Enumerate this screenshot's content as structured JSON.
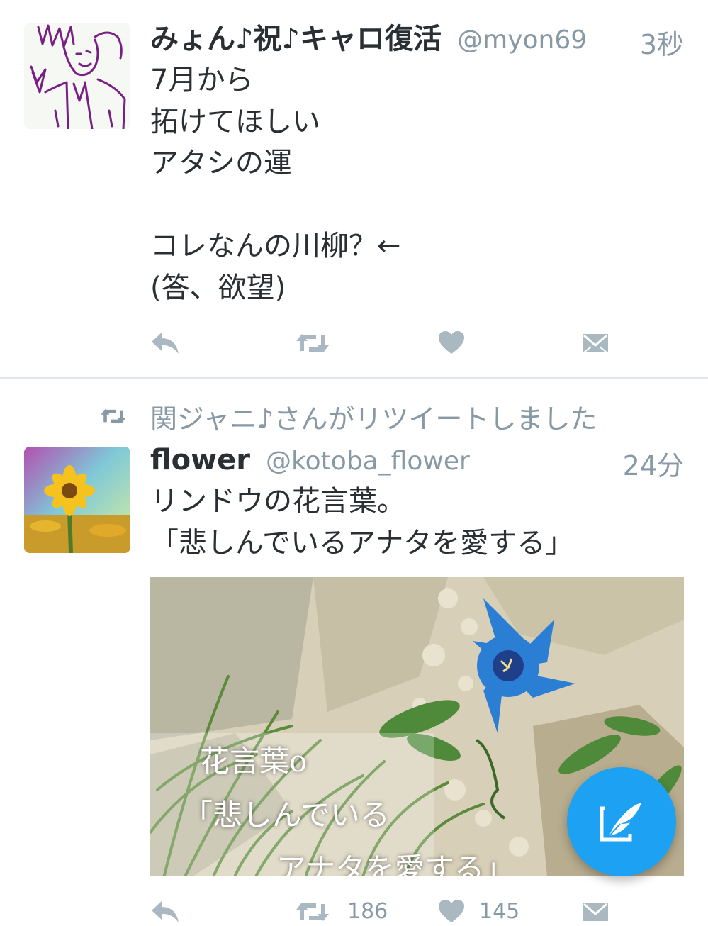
{
  "tweets": [
    {
      "display_name": "みょん♪祝♪キャロ復活",
      "handle": "@myon69",
      "time": "3秒",
      "lines": [
        "7月から",
        "拓けてほしい",
        "アタシの運",
        "",
        "コレなんの川柳？←",
        "(答、欲望)"
      ]
    },
    {
      "retweeted_by": "関ジャニ♪さんがリツイートしました",
      "display_name": "flower",
      "handle": "@kotoba_flower",
      "time": "24分",
      "lines": [
        "リンドウの花言葉。",
        "「悲しんでいるアナタを愛する」"
      ],
      "media_overlay": [
        "花言葉o",
        "「悲しんでいる",
        "アナタを愛する」"
      ],
      "retweet_count": "186",
      "like_count": "145"
    }
  ],
  "icons": {
    "reply": "reply-icon",
    "retweet": "retweet-icon",
    "like": "heart-icon",
    "dm": "envelope-icon",
    "compose": "compose-quill-icon"
  },
  "colors": {
    "accent": "#1da1f2",
    "muted": "#8899a6",
    "text": "#292f33",
    "divider": "#e1e8ed",
    "flower_blue": "#2a7fd4"
  }
}
